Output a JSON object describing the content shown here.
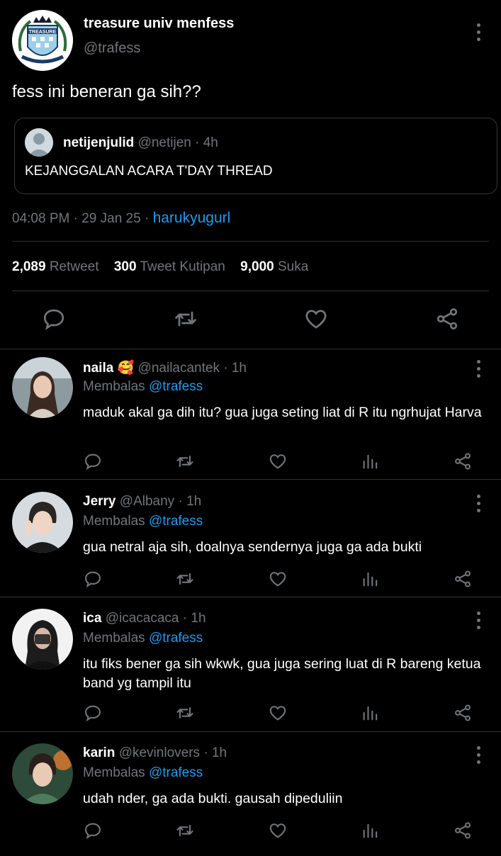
{
  "tweet": {
    "author_name": "treasure univ menfess",
    "author_handle": "@trafess",
    "avatar_text": "TREASURE",
    "text": "fess ini beneran ga sih??",
    "quote": {
      "name": "netijenjulid",
      "handle": "@netijen",
      "time": "4h",
      "text": "KEJANGGALAN ACARA T'DAY THREAD"
    },
    "time": "04:08 PM",
    "date": "29 Jan 25",
    "source": "harukyugurl",
    "stats": [
      {
        "count": "2,089",
        "label": "Retweet"
      },
      {
        "count": "300",
        "label": "Tweet Kutipan"
      },
      {
        "count": "9,000",
        "label": "Suka"
      }
    ]
  },
  "replies": [
    {
      "name": "naila",
      "emoji": "🥰",
      "handle": "@nailacantek",
      "time": "1h",
      "replying_prefix": "Membalas",
      "replying_to": "@trafess",
      "text": "maduk akal ga dih itu? gua juga seting liat di R itu ngrhujat Harva"
    },
    {
      "name": "Jerry",
      "emoji": "",
      "handle": "@Albany",
      "time": "1h",
      "replying_prefix": "Membalas",
      "replying_to": "@trafess",
      "text": "gua netral aja sih, doalnya sendernya juga ga ada bukti"
    },
    {
      "name": "ica",
      "emoji": "",
      "handle": "@icacacaca",
      "time": "1h",
      "replying_prefix": "Membalas",
      "replying_to": "@trafess",
      "text": "itu fiks bener ga sih wkwk, gua juga sering luat di R bareng ketua band yg tampil itu"
    },
    {
      "name": "karin",
      "emoji": "",
      "handle": "@kevinlovers",
      "time": "1h",
      "replying_prefix": "Membalas",
      "replying_to": "@trafess",
      "text": "udah nder, ga ada bukti. gausah dipeduliin"
    }
  ],
  "icons": {
    "reply": "speech-bubble-icon",
    "retweet": "retweet-arrows-icon",
    "like": "heart-icon",
    "views": "bar-chart-icon",
    "share": "share-nodes-icon",
    "more": "vertical-ellipsis-icon"
  },
  "colors": {
    "background": "#000000",
    "text": "#e7e9ea",
    "muted": "#71767b",
    "link": "#1d9bf0",
    "divider": "#2f3336"
  }
}
